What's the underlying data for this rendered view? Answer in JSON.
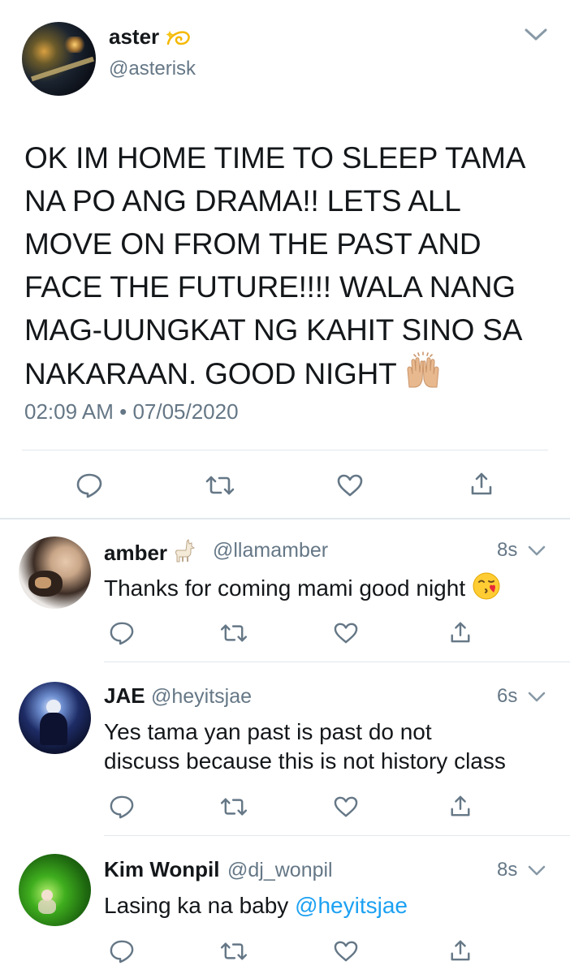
{
  "main_tweet": {
    "author_name": "aster",
    "author_emoji": "dizzy-icon",
    "handle": "@asterisk",
    "text": "OK IM HOME TIME TO SLEEP TAMA NA PO ANG DRAMA!! LETS ALL MOVE ON FROM THE PAST AND FACE THE FUTURE!!!! WALA NANG MAG-UUNGKAT NG KAHIT SINO SA NAKARAAN. GOOD NIGHT",
    "text_emoji": "raising-hands-icon",
    "time": "02:09 AM",
    "dot": "•",
    "date": "07/05/2020"
  },
  "replies": [
    {
      "author_name": "amber",
      "author_emoji": "llama-icon",
      "handle": "@llamamber",
      "time": "8s",
      "text": "Thanks for coming mami good night",
      "text_emoji": "face-blowing-kiss-icon"
    },
    {
      "author_name": "JAE",
      "handle": "@heyitsjae",
      "time": "6s",
      "text_line1": "Yes tama yan past is past do not",
      "text_line2": "discuss because this is not history class"
    },
    {
      "author_name": "Kim Wonpil",
      "handle": "@dj_wonpil",
      "time": "8s",
      "text": "Lasing ka na baby ",
      "mention": "@heyitsjae"
    }
  ],
  "colors": {
    "text": "#14171a",
    "secondary": "#657786",
    "icon": "#657786",
    "link": "#1da1f2",
    "divider": "#e1e8ed"
  },
  "icons": [
    "reply-icon",
    "retweet-icon",
    "like-icon",
    "share-icon",
    "chevron-down-icon"
  ]
}
